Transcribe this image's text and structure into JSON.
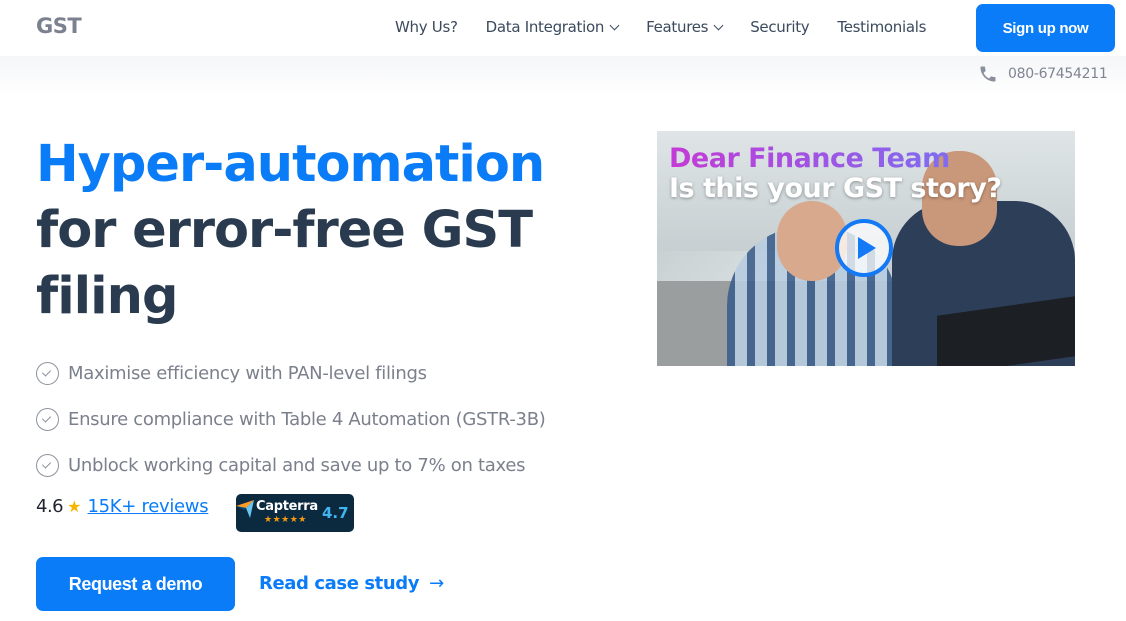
{
  "header": {
    "logo": "GST",
    "nav": [
      {
        "label": "Why Us?",
        "dropdown": false
      },
      {
        "label": "Data Integration",
        "dropdown": true
      },
      {
        "label": "Features",
        "dropdown": true
      },
      {
        "label": "Security",
        "dropdown": false
      },
      {
        "label": "Testimonials",
        "dropdown": false
      }
    ],
    "signup_label": "Sign up now",
    "phone": "080-67454211"
  },
  "hero": {
    "title_accent": "Hyper-automation",
    "title_line2": "for error-free GST",
    "title_line3": "filing",
    "features": [
      "Maximise efficiency with PAN-level filings",
      "Ensure compliance with Table 4 Automation (GSTR-3B)",
      "Unblock working capital and save up to 7% on taxes"
    ],
    "rating": "4.6",
    "star": "★",
    "reviews_link": "15K+ reviews",
    "capterra": {
      "name": "Capterra",
      "stars": "★★★★★",
      "score": "4.7"
    },
    "demo_label": "Request a demo",
    "case_study_label": "Read case study",
    "case_study_arrow": "→"
  },
  "video": {
    "headline1": "Dear Finance Team",
    "headline2": "Is this your GST story?"
  },
  "colors": {
    "accent": "#0a7cf8",
    "heading": "#2a3b4f",
    "muted": "#7b808d",
    "star": "#f7b500",
    "capterra_bg": "#0b2a40"
  }
}
